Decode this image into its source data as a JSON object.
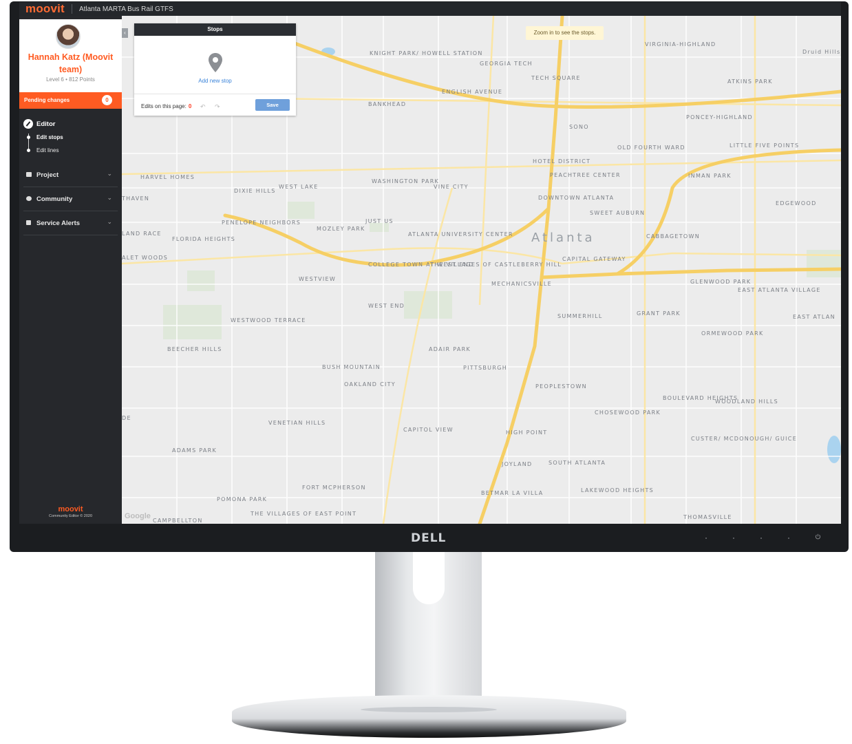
{
  "app": {
    "logo": "moovit",
    "project_title": "Atlanta MARTA Bus Rail GTFS"
  },
  "user": {
    "name": "Hannah Katz (Moovit team)",
    "level": "Level 6",
    "points": "812 Points",
    "level_points": "Level 6 • 812 Points"
  },
  "pending": {
    "label": "Pending changes",
    "count": "0"
  },
  "nav": {
    "editor": "Editor",
    "edit_stops": "Edit stops",
    "edit_lines": "Edit lines",
    "sections": [
      {
        "label": "Project",
        "icon": "folder-icon"
      },
      {
        "label": "Community",
        "icon": "chat-icon"
      },
      {
        "label": "Service Alerts",
        "icon": "megaphone-icon"
      }
    ]
  },
  "footer": {
    "logo": "moovit",
    "text": "Community Editor © 2020"
  },
  "stops_panel": {
    "title": "Stops",
    "add_stop": "Add new stop",
    "edits_label": "Edits on this page:",
    "edits_count": "0",
    "save": "Save"
  },
  "map": {
    "zoom_tip": "Zoom in to see the stops.",
    "attribution": "Google",
    "city": "Atlanta",
    "neighborhoods": [
      "KNIGHT PARK/ HOWELL STATION",
      "GEORGIA TECH",
      "VIRGINIA-HIGHLAND",
      "Druid Hills",
      "TECH SQUARE",
      "ATKINS PARK",
      "ENGLISH AVENUE",
      "BANKHEAD",
      "SONO",
      "PONCEY-HIGHLAND",
      "OLD FOURTH WARD",
      "LITTLE FIVE POINTS",
      "HOTEL DISTRICT",
      "PEACHTREE CENTER",
      "INMAN PARK",
      "HARVEL HOMES",
      "WASHINGTON PARK",
      "VINE CITY",
      "DIXIE HILLS",
      "WEST LAKE",
      "DOWNTOWN ATLANTA",
      "EDGEWOOD",
      "SWEET AUBURN",
      "PENELOPE NEIGHBORS",
      "JUST US",
      "MOZLEY PARK",
      "FLORIDA HEIGHTS",
      "ATLANTA UNIVERSITY CENTER",
      "CABBAGETOWN",
      "CAPITAL GATEWAY",
      "COLLEGE TOWN AT WEST END",
      "THE VILLAGES OF CASTLEBERRY HILL",
      "WESTVIEW",
      "MECHANICSVILLE",
      "GLENWOOD PARK",
      "EAST ATLANTA VILLAGE",
      "WEST END",
      "SUMMERHILL",
      "GRANT PARK",
      "EAST ATLAN",
      "WESTWOOD TERRACE",
      "ORMEWOOD PARK",
      "ADAIR PARK",
      "BEECHER HILLS",
      "BUSH MOUNTAIN",
      "PITTSBURGH",
      "OAKLAND CITY",
      "PEOPLESTOWN",
      "BOULEVARD HEIGHTS",
      "WOODLAND HILLS",
      "CHOSEWOOD PARK",
      "VENETIAN HILLS",
      "CAPITOL VIEW",
      "HIGH POINT",
      "CUSTER/ MCDONOUGH/ GUICE",
      "ADAMS PARK",
      "JOYLAND",
      "SOUTH ATLANTA",
      "FORT MCPHERSON",
      "LAKEWOOD HEIGHTS",
      "POMONA PARK",
      "BETMAR LA VILLA",
      "THE VILLAGES OF EAST POINT",
      "THOMASVILLE",
      "CAMPBELLTON",
      "ALET WOODS",
      "THAVEN",
      "LAND RACE",
      "DE"
    ]
  },
  "device": {
    "brand": "DELL"
  }
}
